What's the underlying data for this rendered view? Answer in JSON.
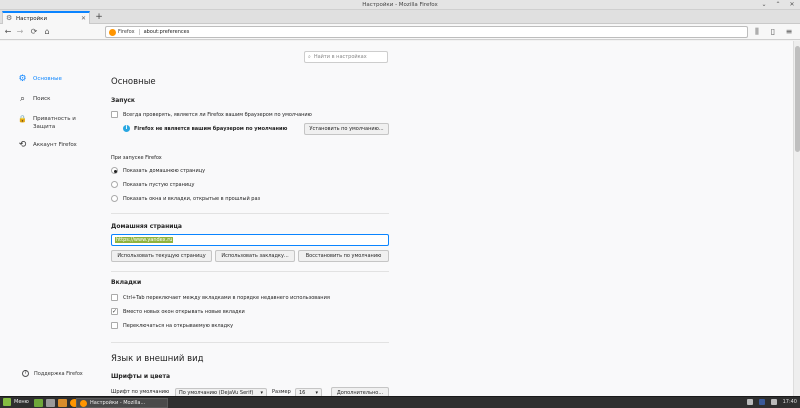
{
  "window": {
    "title": "Настройки - Mozilla Firefox",
    "minimize_glyph": "⌄",
    "maximize_glyph": "⌃",
    "close_glyph": "✕"
  },
  "tab": {
    "label": "Настройки",
    "close_glyph": "✕"
  },
  "newtab_glyph": "+",
  "nav": {
    "back_glyph": "←",
    "forward_glyph": "→",
    "reload_glyph": "⟳",
    "home_glyph": "⌂",
    "identity": "Firefox",
    "url": "about:preferences",
    "library_glyph": "⫼",
    "sidebar_glyph": "▯",
    "menu_glyph": "≡"
  },
  "search": {
    "placeholder": "Найти в настройках",
    "icon": "⌕"
  },
  "sidebar": {
    "items": [
      {
        "label": "Основные",
        "icon": "⚙"
      },
      {
        "label": "Поиск",
        "icon": "⌕"
      },
      {
        "label": "Приватность и Защита",
        "icon": "🔒"
      },
      {
        "label": "Аккаунт Firefox",
        "icon": "⟲"
      }
    ],
    "support": "Поддержка Firefox"
  },
  "main": {
    "heading": "Основные",
    "startup": {
      "title": "Запуск",
      "default_check": "Всегда проверять, является ли Firefox вашим браузером по умолчанию",
      "not_default_msg": "Firefox не является вашим браузером по умолчанию",
      "set_default_btn": "Установить по умолчанию...",
      "on_start_label": "При запуске Firefox",
      "options": [
        "Показать домашнюю страницу",
        "Показать пустую страницу",
        "Показать окна и вкладки, открытые в прошлый раз"
      ]
    },
    "home": {
      "title": "Домашняя страница",
      "value": "https://www.yandex.ru",
      "btn_current": "Использовать текущую страницу",
      "btn_bookmark": "Использовать закладку...",
      "btn_restore": "Восстановить по умолчанию"
    },
    "tabs": {
      "title": "Вкладки",
      "items": [
        {
          "label": "Ctrl+Tab переключает между вкладками в порядке недавнего использования",
          "checked": false
        },
        {
          "label": "Вместо новых окон открывать новые вкладки",
          "checked": true
        },
        {
          "label": "Переключаться на открываемую вкладку",
          "checked": false
        }
      ],
      "check_glyph": "✓"
    },
    "language": {
      "title": "Язык и внешний вид",
      "fonts_title": "Шрифты и цвета",
      "default_font_label": "Шрифт по умолчанию",
      "default_font_value": "По умолчанию (DejaVu Serif)",
      "size_label": "Размер",
      "size_value": "16",
      "advanced_btn": "Дополнительно...",
      "dropdown_glyph": "▾"
    }
  },
  "taskbar": {
    "menu": "Меню",
    "task": "Настройки - Mozilla...",
    "clock": "17:40"
  }
}
